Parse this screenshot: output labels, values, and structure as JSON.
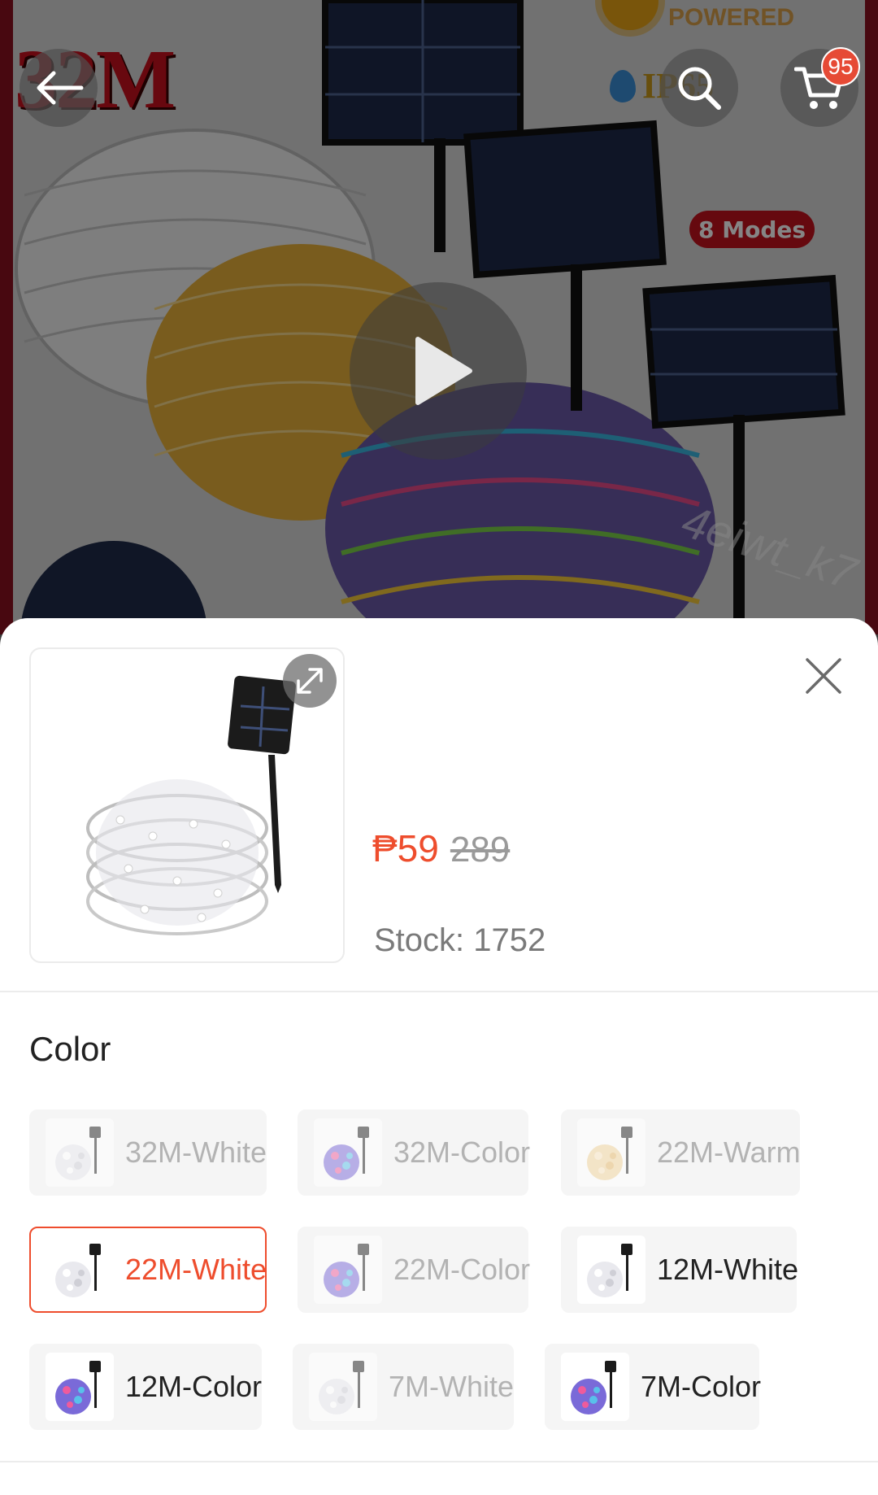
{
  "hero": {
    "headline": "32M",
    "powered_text": "POWERED",
    "ip_text": "IP65",
    "modes_badge": "8 Modes",
    "watermark": "4eiwt_k7",
    "cart_count": "95",
    "icons": {
      "back": "arrow-left-icon",
      "search": "search-icon",
      "cart": "cart-icon",
      "play": "play-icon"
    }
  },
  "sheet": {
    "price": {
      "current": "₱59",
      "original": "289"
    },
    "stock_text": "Stock: 1752",
    "section_title": "Color",
    "options": [
      {
        "label": "32M-White",
        "swatch": "white",
        "state": "disabled"
      },
      {
        "label": "32M-Color",
        "swatch": "color",
        "state": "disabled"
      },
      {
        "label": "22M-Warm",
        "swatch": "warm",
        "state": "disabled"
      },
      {
        "label": "22M-White",
        "swatch": "white",
        "state": "selected"
      },
      {
        "label": "22M-Color",
        "swatch": "color",
        "state": "disabled"
      },
      {
        "label": "12M-White",
        "swatch": "white",
        "state": "available"
      },
      {
        "label": "12M-Color",
        "swatch": "color",
        "state": "available"
      },
      {
        "label": "7M-White",
        "swatch": "white",
        "state": "disabled"
      },
      {
        "label": "7M-Color",
        "swatch": "color",
        "state": "available"
      }
    ],
    "icons": {
      "close": "close-icon",
      "expand": "expand-icon"
    }
  },
  "colors": {
    "accent": "#ee4d2d",
    "disabled_text": "#b3b3b3",
    "chip_bg": "#f5f5f5"
  }
}
